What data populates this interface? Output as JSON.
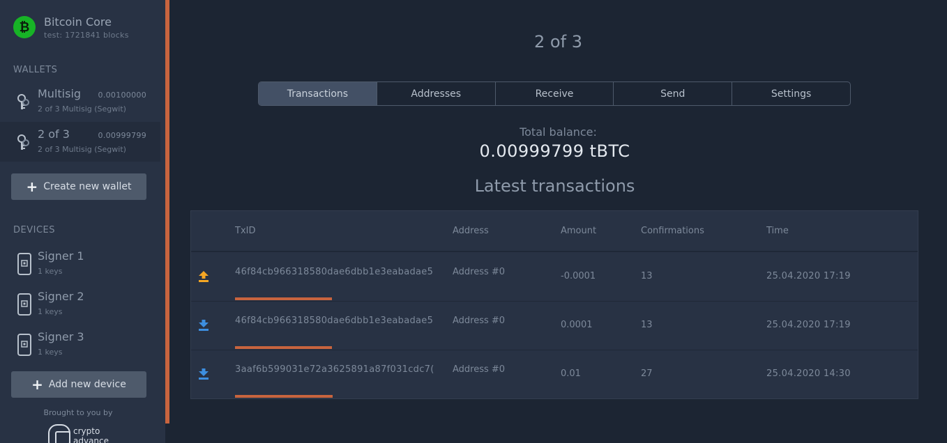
{
  "app": {
    "title": "Bitcoin Core",
    "subtitle": "test: 1721841 blocks",
    "logo_icon": "bitcoin-icon",
    "brand_color": "#17b326"
  },
  "sidebar": {
    "wallets_label": "WALLETS",
    "wallets": [
      {
        "name": "Multisig",
        "balance": "0.00100000",
        "desc": "2 of 3 Multisig (Segwit)",
        "icon": "keys-icon",
        "active": false
      },
      {
        "name": "2 of 3",
        "balance": "0.00999799",
        "desc": "2 of 3 Multisig (Segwit)",
        "icon": "keys-icon",
        "active": true
      }
    ],
    "create_wallet_label": "Create new wallet",
    "devices_label": "DEVICES",
    "devices": [
      {
        "name": "Signer 1",
        "desc": "1 keys",
        "icon": "hardware-device-icon"
      },
      {
        "name": "Signer 2",
        "desc": "1 keys",
        "icon": "hardware-device-icon"
      },
      {
        "name": "Signer 3",
        "desc": "1 keys",
        "icon": "hardware-device-icon"
      }
    ],
    "add_device_label": "Add new device",
    "brought_by": "Brought to you by",
    "sponsor_logo_text": "crypto advance"
  },
  "main": {
    "wallet_title": "2 of 3",
    "tabs": [
      "Transactions",
      "Addresses",
      "Receive",
      "Send",
      "Settings"
    ],
    "active_tab": "Transactions",
    "total_balance_label": "Total balance:",
    "total_balance_value": "0.00999799 tBTC",
    "latest_label": "Latest transactions",
    "table": {
      "headers": [
        "TxID",
        "Address",
        "Amount",
        "Confirmations",
        "Time"
      ],
      "rows": [
        {
          "direction": "outgoing",
          "icon": "upload-arrow-icon",
          "txid": "46f84cb966318580dae6dbb1e3eabadae5",
          "address": "Address #0",
          "amount": "-0.0001",
          "confirmations": "13",
          "time": "25.04.2020 17:19"
        },
        {
          "direction": "incoming",
          "icon": "download-arrow-icon",
          "txid": "46f84cb966318580dae6dbb1e3eabadae5",
          "address": "Address #0",
          "amount": "0.0001",
          "confirmations": "13",
          "time": "25.04.2020 17:19"
        },
        {
          "direction": "incoming",
          "icon": "download-arrow-icon",
          "txid": "3aaf6b599031e72a3625891a87f031cdc7(",
          "address": "Address #0",
          "amount": "0.01",
          "confirmations": "27",
          "time": "25.04.2020 14:30"
        }
      ]
    }
  },
  "colors": {
    "accent": "#c8643e",
    "outgoing": "#f5a623",
    "incoming": "#3d8fe0"
  }
}
